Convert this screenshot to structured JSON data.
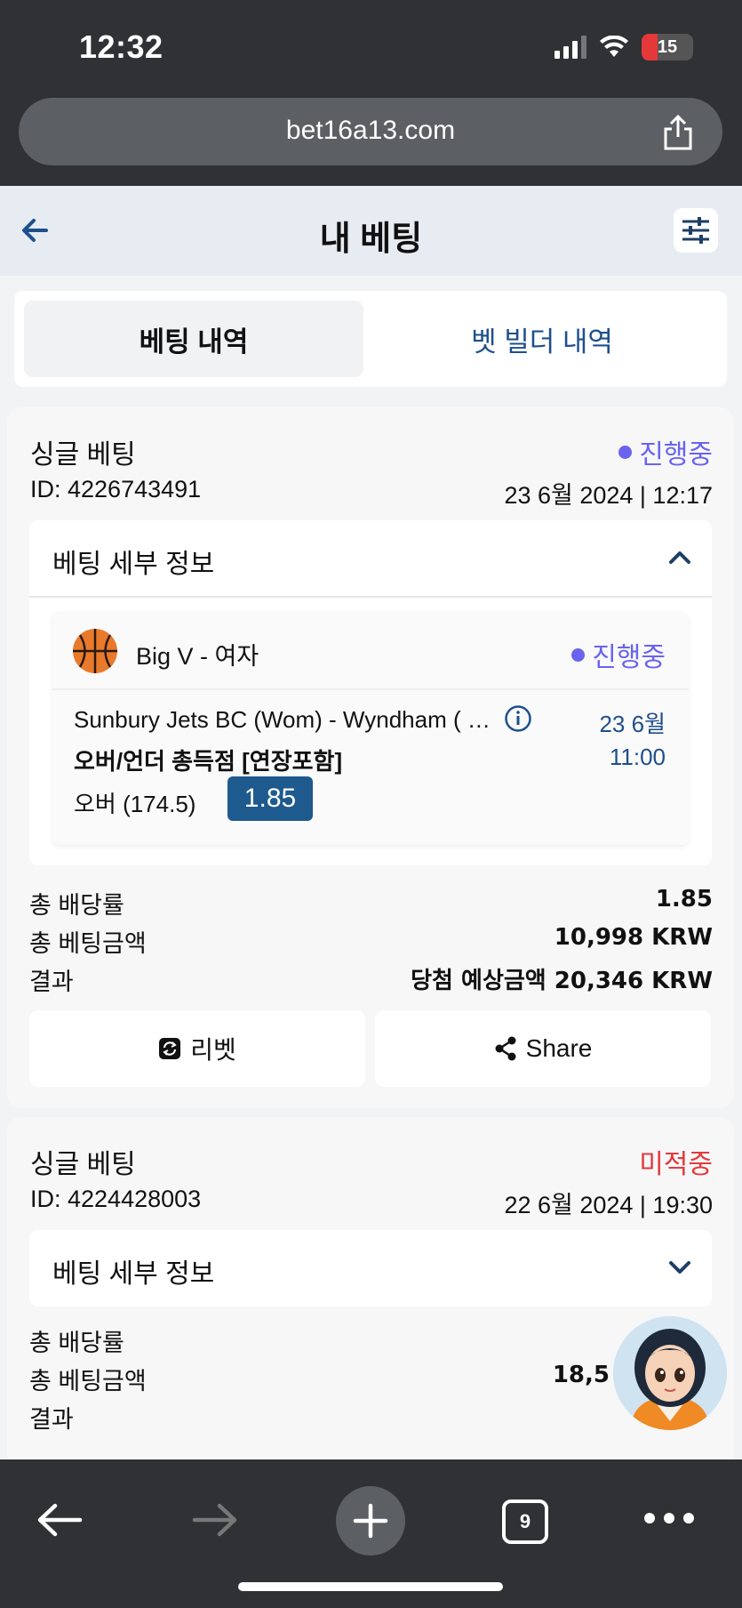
{
  "status_bar": {
    "time": "12:32",
    "battery": "15"
  },
  "browser": {
    "url": "bet16a13.com",
    "tab_count": "9"
  },
  "header": {
    "title": "내 베팅"
  },
  "tabs": [
    {
      "label": "베팅 내역",
      "active": true
    },
    {
      "label": "벳 빌더 내역",
      "active": false
    }
  ],
  "bets": [
    {
      "type": "싱글 베팅",
      "status": "진행중",
      "id": "ID: 4226743491",
      "date": "23 6월 2024 | 12:17",
      "details_title": "베팅 세부 정보",
      "event": {
        "league": "Big V - 여자",
        "status": "진행중",
        "match": "Sunbury Jets BC (Wom) - Wyndham ( …",
        "market": "오버/언더 총득점 [연장포함]",
        "selection": "오버 (174.5)",
        "odds": "1.85",
        "date": "23 6월",
        "time": "11:00"
      },
      "summary": [
        {
          "label": "총 배당률",
          "value": "1.85"
        },
        {
          "label": "총 베팅금액",
          "value": "10,998 KRW"
        },
        {
          "label": "결과",
          "value": "당첨 예상금액 20,346 KRW"
        }
      ],
      "actions": {
        "rebet": "리벳",
        "share": "Share"
      }
    },
    {
      "type": "싱글 베팅",
      "status": "미적중",
      "id": "ID: 4224428003",
      "date": "22 6월 2024 | 19:30",
      "details_title": "베팅 세부 정보",
      "summary": [
        {
          "label": "총 배당률",
          "value": ""
        },
        {
          "label": "총 베팅금액",
          "value": "18,5"
        },
        {
          "label": "결과",
          "value": ""
        }
      ]
    }
  ],
  "colors": {
    "accent_live": "#6a63ef",
    "accent_lost": "#e5383b",
    "brand_blue": "#1e5a8e",
    "link_blue": "#1e4f8c"
  }
}
